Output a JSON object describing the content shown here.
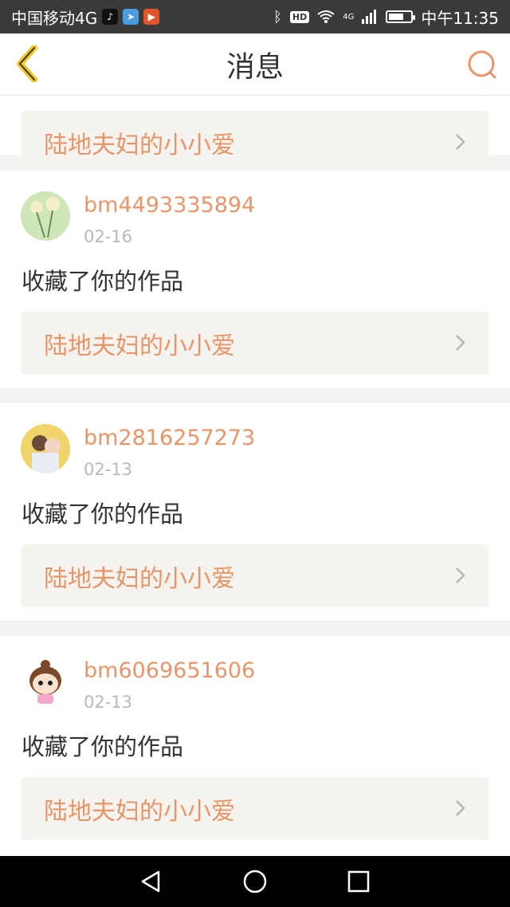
{
  "status_bar": {
    "carrier": "中国移动4G",
    "time": "中午11:35",
    "hd": "HD",
    "network": "4G",
    "battery_level": 0.7
  },
  "header": {
    "title": "消息",
    "back_icon": "chevron-left-icon",
    "search_icon": "search-icon"
  },
  "colors": {
    "accent": "#e8956a",
    "back_yellow": "#f3c623",
    "card_bg": "#ffffff",
    "link_bg": "#f4f3ee",
    "page_bg": "#f3f3f3"
  },
  "messages": [
    {
      "username": "",
      "date": "",
      "action": "",
      "work": "陆地夫妇的小小爱"
    },
    {
      "username": "bm4493335894",
      "date": "02-16",
      "action": "收藏了你的作品",
      "work": "陆地夫妇的小小爱"
    },
    {
      "username": "bm2816257273",
      "date": "02-13",
      "action": "收藏了你的作品",
      "work": "陆地夫妇的小小爱"
    },
    {
      "username": "bm6069651606",
      "date": "02-13",
      "action": "收藏了你的作品",
      "work": "陆地夫妇的小小爱"
    }
  ],
  "nav_bar": {
    "back": "triangle-back-icon",
    "home": "circle-home-icon",
    "recents": "square-recents-icon"
  }
}
